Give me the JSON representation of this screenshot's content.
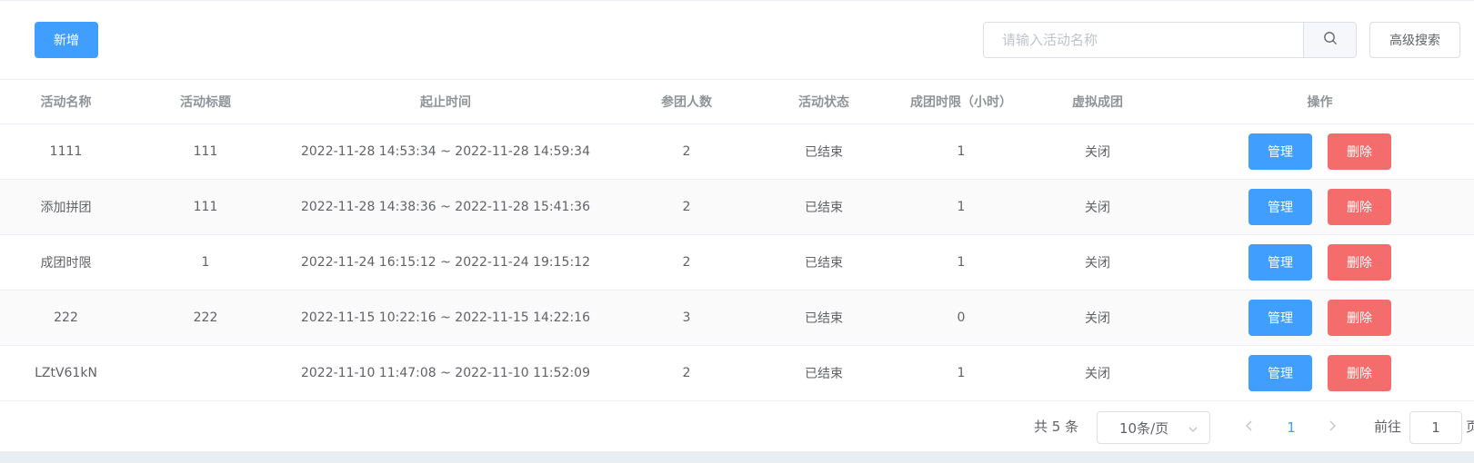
{
  "toolbar": {
    "add_label": "新增",
    "search_placeholder": "请输入活动名称",
    "search_value": "",
    "advanced_label": "高级搜索"
  },
  "table": {
    "headers": [
      "活动名称",
      "活动标题",
      "起止时间",
      "参团人数",
      "活动状态",
      "成团时限（小时）",
      "虚拟成团",
      "操作"
    ],
    "rows": [
      {
        "name": "1111",
        "title": "111",
        "time": "2022-11-28 14:53:34 ~ 2022-11-28 14:59:34",
        "people": "2",
        "status": "已结束",
        "limit": "1",
        "virtual": "关闭"
      },
      {
        "name": "添加拼团",
        "title": "111",
        "time": "2022-11-28 14:38:36 ~ 2022-11-28 15:41:36",
        "people": "2",
        "status": "已结束",
        "limit": "1",
        "virtual": "关闭"
      },
      {
        "name": "成团时限",
        "title": "1",
        "time": "2022-11-24 16:15:12 ~ 2022-11-24 19:15:12",
        "people": "2",
        "status": "已结束",
        "limit": "1",
        "virtual": "关闭"
      },
      {
        "name": "222",
        "title": "222",
        "time": "2022-11-15 10:22:16 ~ 2022-11-15 14:22:16",
        "people": "3",
        "status": "已结束",
        "limit": "0",
        "virtual": "关闭"
      },
      {
        "name": "LZtV61kN",
        "title": "",
        "time": "2022-11-10 11:47:08 ~ 2022-11-10 11:52:09",
        "people": "2",
        "status": "已结束",
        "limit": "1",
        "virtual": "关闭"
      }
    ],
    "manage_label": "管理",
    "delete_label": "删除"
  },
  "pagination": {
    "total_text": "共 5 条",
    "page_size": "10条/页",
    "current_page": "1",
    "goto_label": "前往",
    "goto_value": "1",
    "goto_suffix": "页"
  },
  "icons": {
    "search": "search-icon",
    "dropdown": "chevron-down-icon",
    "prev": "chevron-left-icon",
    "next": "chevron-right-icon"
  },
  "colors": {
    "primary": "#409eff",
    "danger": "#f56c6c",
    "border": "#ebeef5",
    "stripe": "#fafafa"
  }
}
